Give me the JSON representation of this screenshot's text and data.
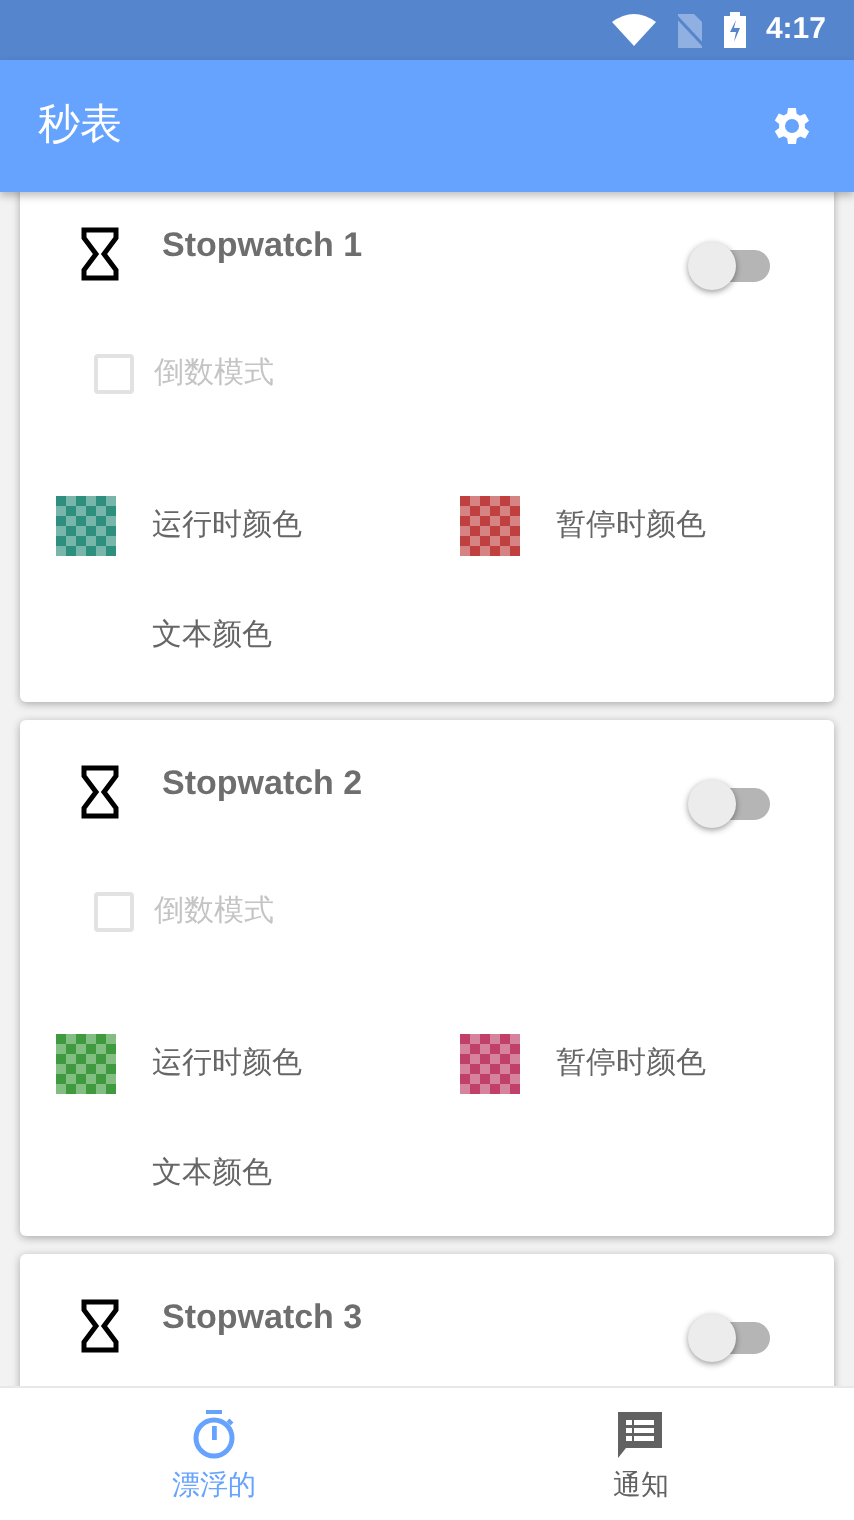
{
  "status_bar": {
    "time": "4:17"
  },
  "app_bar": {
    "title": "秒表"
  },
  "stopwatches": [
    {
      "name": "Stopwatch 1",
      "on": false,
      "countdown": {
        "label": "倒数模式",
        "checked": false,
        "disabled": true
      },
      "run_color": {
        "label": "运行时颜色",
        "color": "#2f8f7f"
      },
      "pause_color": {
        "label": "暂停时颜色",
        "color": "#c04040"
      },
      "text_color": {
        "label": "文本颜色"
      }
    },
    {
      "name": "Stopwatch 2",
      "on": false,
      "countdown": {
        "label": "倒数模式",
        "checked": false,
        "disabled": true
      },
      "run_color": {
        "label": "运行时颜色",
        "color": "#3f9a3f"
      },
      "pause_color": {
        "label": "暂停时颜色",
        "color": "#c0406a"
      },
      "text_color": {
        "label": "文本颜色"
      }
    },
    {
      "name": "Stopwatch 3",
      "on": false
    }
  ],
  "bottom_nav": [
    {
      "label": "漂浮的",
      "kind": "stopwatch",
      "selected": true
    },
    {
      "label": "通知",
      "kind": "message",
      "selected": false
    }
  ]
}
